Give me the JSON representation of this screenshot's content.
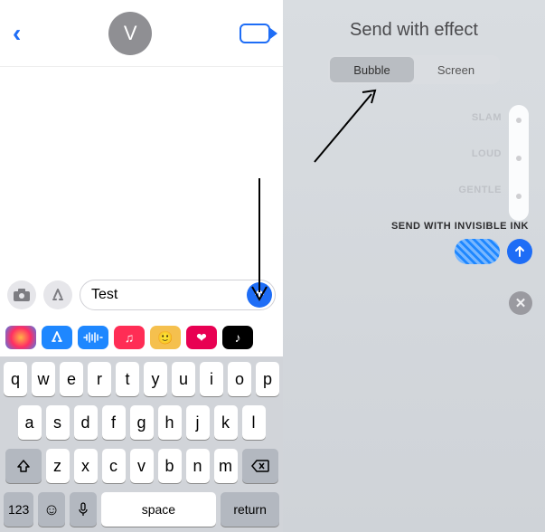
{
  "left": {
    "avatar_initial": "V",
    "message_value": "Test",
    "app_icons": [
      "photos",
      "appstore",
      "audio",
      "music",
      "memoji",
      "digital-touch",
      "tiktok"
    ],
    "keyboard": {
      "row1": [
        "q",
        "w",
        "e",
        "r",
        "t",
        "y",
        "u",
        "i",
        "o",
        "p"
      ],
      "row2": [
        "a",
        "s",
        "d",
        "f",
        "g",
        "h",
        "j",
        "k",
        "l"
      ],
      "row3": [
        "z",
        "x",
        "c",
        "v",
        "b",
        "n",
        "m"
      ],
      "num_label": "123",
      "space_label": "space",
      "return_label": "return"
    }
  },
  "right": {
    "title": "Send with effect",
    "tab_bubble": "Bubble",
    "tab_screen": "Screen",
    "effects": {
      "slam": "SLAM",
      "loud": "LOUD",
      "gentle": "GENTLE",
      "invisible": "SEND WITH INVISIBLE INK"
    }
  }
}
